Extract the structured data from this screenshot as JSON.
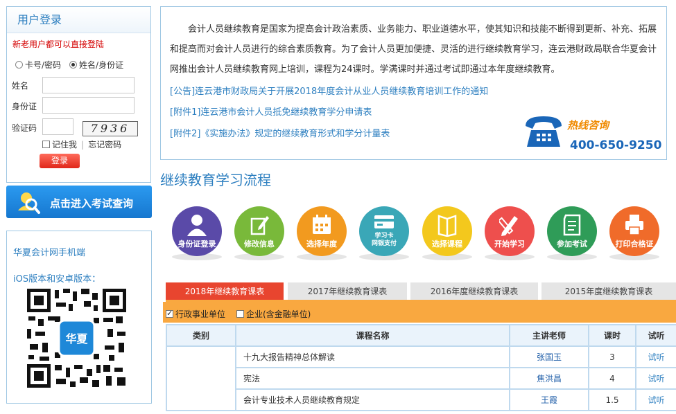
{
  "login": {
    "title": "用户登录",
    "notice": "新老用户都可以直接登陆",
    "radio_card": "卡号/密码",
    "radio_name": "姓名/身份证",
    "name_label": "姓名",
    "id_label": "身份证",
    "captcha_label": "验证码",
    "captcha_text": "7936",
    "remember_label": "记住我",
    "forgot_label": "忘记密码",
    "login_button": "登录"
  },
  "exam_query": {
    "label": "点击进入考试查询"
  },
  "mobile": {
    "title": "华夏会计网手机端",
    "subtitle": "iOS版本和安卓版本：",
    "qr_logo_text": "华夏"
  },
  "intro": {
    "paragraph": "会计人员继续教育是国家为提高会计政治素质、业务能力、职业道德水平，使其知识和技能不断得到更新、补充、拓展和提高而对会计人员进行的综合素质教育。为了会计人员更加便捷、灵活的进行继续教育学习，连云港财政局联合华夏会计网推出会计人员继续教育网上培训，课程为24课时。学满课时并通过考试即通过本年度继续教育。",
    "links": [
      "[公告]连云港市财政局关于开展2018年度会计从业人员继续教育培训工作的通知",
      "[附件1]连云港市会计人员抵免继续教育学分申请表",
      "[附件2]《实施办法》规定的继续教育形式和学分计量表"
    ],
    "hotline_label": "热线咨询",
    "hotline_number": "400-650-9250"
  },
  "flow": {
    "title": "继续教育学习流程",
    "steps": [
      {
        "label": "身份证登录",
        "color": "#5a4aa8",
        "icon": "person-icon"
      },
      {
        "label": "修改信息",
        "color": "#79b93a",
        "icon": "pencil-icon"
      },
      {
        "label": "选择年度",
        "color": "#f29a1f",
        "icon": "calendar-icon"
      },
      {
        "label_line1": "学习卡",
        "label_line2": "网银支付",
        "color": "#3aa7b7",
        "icon": "card-icon"
      },
      {
        "label": "选择课程",
        "color": "#f3c81d",
        "icon": "book-icon"
      },
      {
        "label": "开始学习",
        "color": "#ee4f4d",
        "icon": "pencil-ruler-icon"
      },
      {
        "label": "参加考试",
        "color": "#2f9c58",
        "icon": "exam-paper-icon"
      },
      {
        "label": "打印合格证",
        "color": "#f06b2a",
        "icon": "printer-icon"
      }
    ]
  },
  "tabs": [
    "2018年继续教育课表",
    "2017年继续教育课表",
    "2016年度继续教育课表",
    "2015年度继续教育课表"
  ],
  "filters": {
    "gov_label": "行政事业单位",
    "gov_checked": true,
    "corp_label": "企业(含金融单位)",
    "corp_checked": false
  },
  "table": {
    "headers": [
      "类别",
      "课程名称",
      "主讲老师",
      "课时",
      "试听"
    ],
    "rows": [
      {
        "name": "十九大报告精神总体解读",
        "teacher": "张国玉",
        "hours": "3",
        "trial": "试听"
      },
      {
        "name": "宪法",
        "teacher": "焦洪昌",
        "hours": "4",
        "trial": "试听"
      },
      {
        "name": "会计专业技术人员继续教育规定",
        "teacher": "王霞",
        "hours": "1.5",
        "trial": "试听"
      }
    ]
  }
}
